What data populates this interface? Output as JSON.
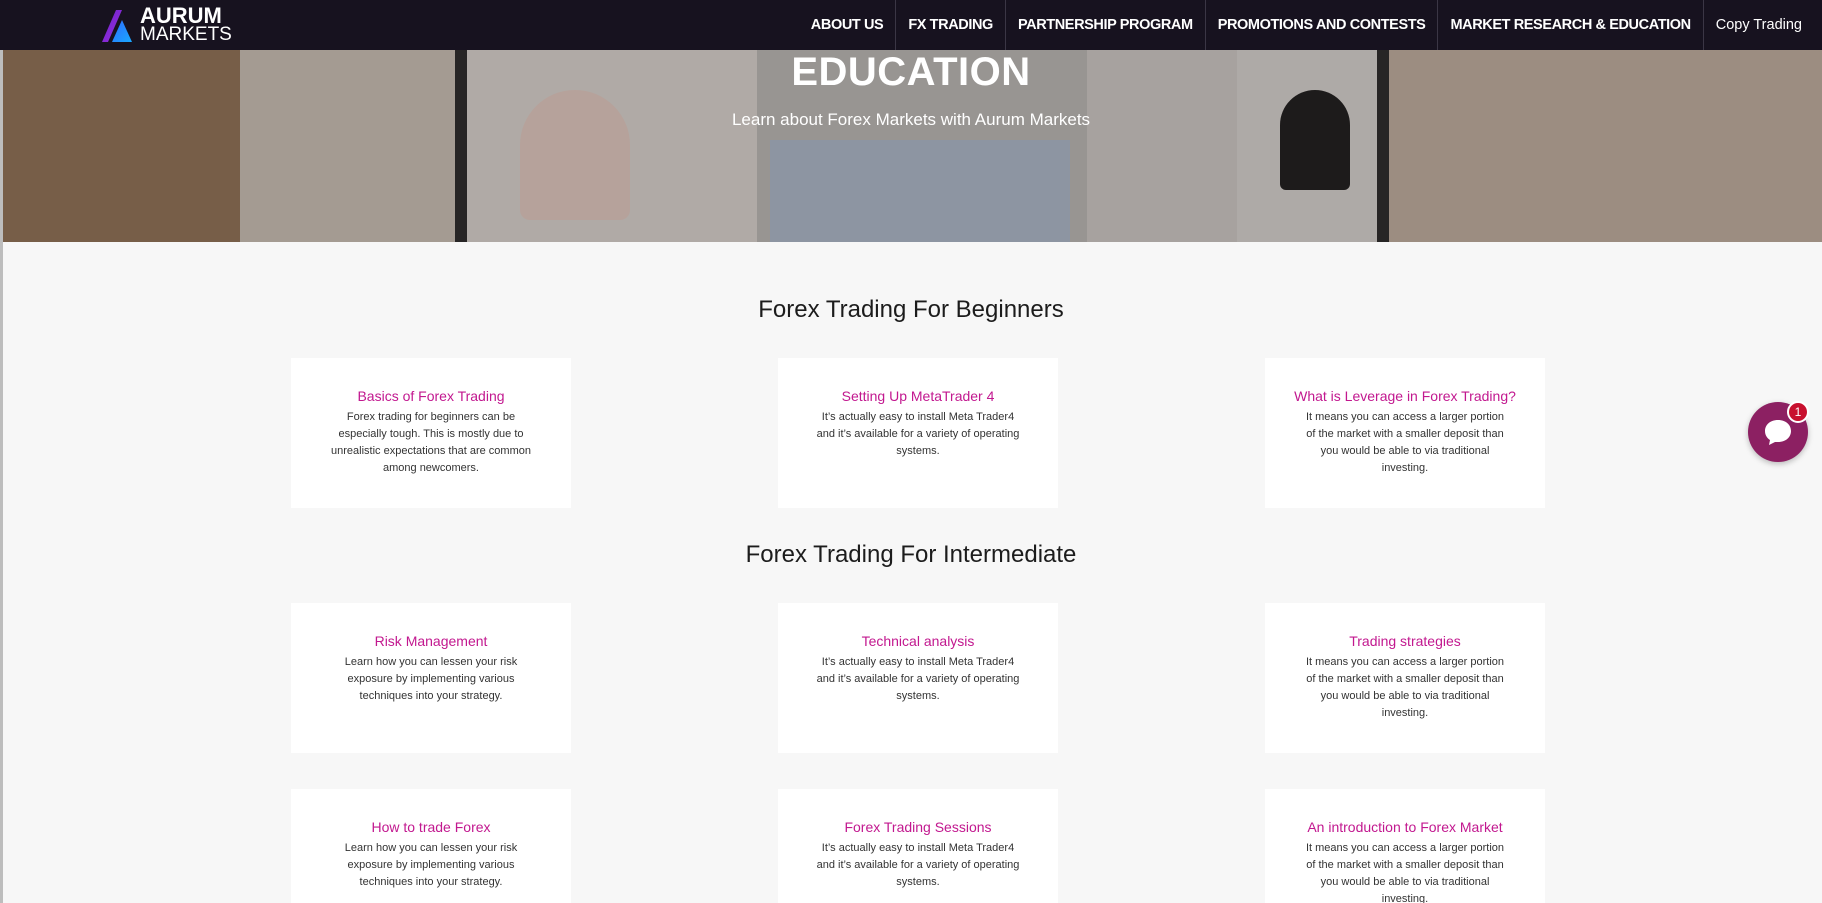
{
  "brand": {
    "line1": "AURUM",
    "line2": "MARKETS"
  },
  "nav": {
    "items": [
      {
        "label": "ABOUT US"
      },
      {
        "label": "FX TRADING"
      },
      {
        "label": "PARTNERSHIP PROGRAM"
      },
      {
        "label": "PROMOTIONS AND CONTESTS"
      },
      {
        "label": "MARKET RESEARCH & EDUCATION"
      },
      {
        "label": "Copy Trading"
      }
    ]
  },
  "hero": {
    "title": "EDUCATION",
    "subtitle": "Learn about Forex Markets with Aurum Markets"
  },
  "sections": [
    {
      "title": "Forex Trading For Beginners",
      "cards": [
        {
          "title": "Basics of Forex Trading",
          "text": "Forex trading for beginners can be especially tough. This is mostly due to unrealistic expectations that are common among newcomers."
        },
        {
          "title": "Setting Up MetaTrader 4",
          "text": "It’s actually easy to install Meta Trader4 and it’s available for a variety of operating systems."
        },
        {
          "title": "What is Leverage in Forex Trading?",
          "text": "It means you can access a larger portion of the market with a smaller deposit than you would be able to via traditional investing."
        }
      ]
    },
    {
      "title": "Forex Trading For Intermediate",
      "cards": [
        {
          "title": "Risk Management",
          "text": "Learn how you can lessen your risk exposure by implementing various techniques into your strategy."
        },
        {
          "title": "Technical analysis",
          "text": "It’s actually easy to install Meta Trader4 and it’s available for a variety of operating systems."
        },
        {
          "title": "Trading strategies",
          "text": "It means you can access a larger portion of the market with a smaller deposit than you would be able to via traditional investing."
        },
        {
          "title": "How to trade Forex",
          "text": "Learn how you can lessen your risk exposure by implementing various techniques into your strategy."
        },
        {
          "title": "Forex Trading Sessions",
          "text": "It’s actually easy to install Meta Trader4 and it’s available for a variety of operating systems."
        },
        {
          "title": "An introduction to Forex Market",
          "text": "It means you can access a larger portion of the market with a smaller deposit than you would be able to via traditional investing."
        }
      ]
    }
  ],
  "chat": {
    "badge": "1",
    "icon": "chat-bubble-icon"
  },
  "colors": {
    "nav_bg": "#17121f",
    "accent": "#c2188f",
    "chat": "#8c2062",
    "page_bg": "#f7f7f7"
  }
}
